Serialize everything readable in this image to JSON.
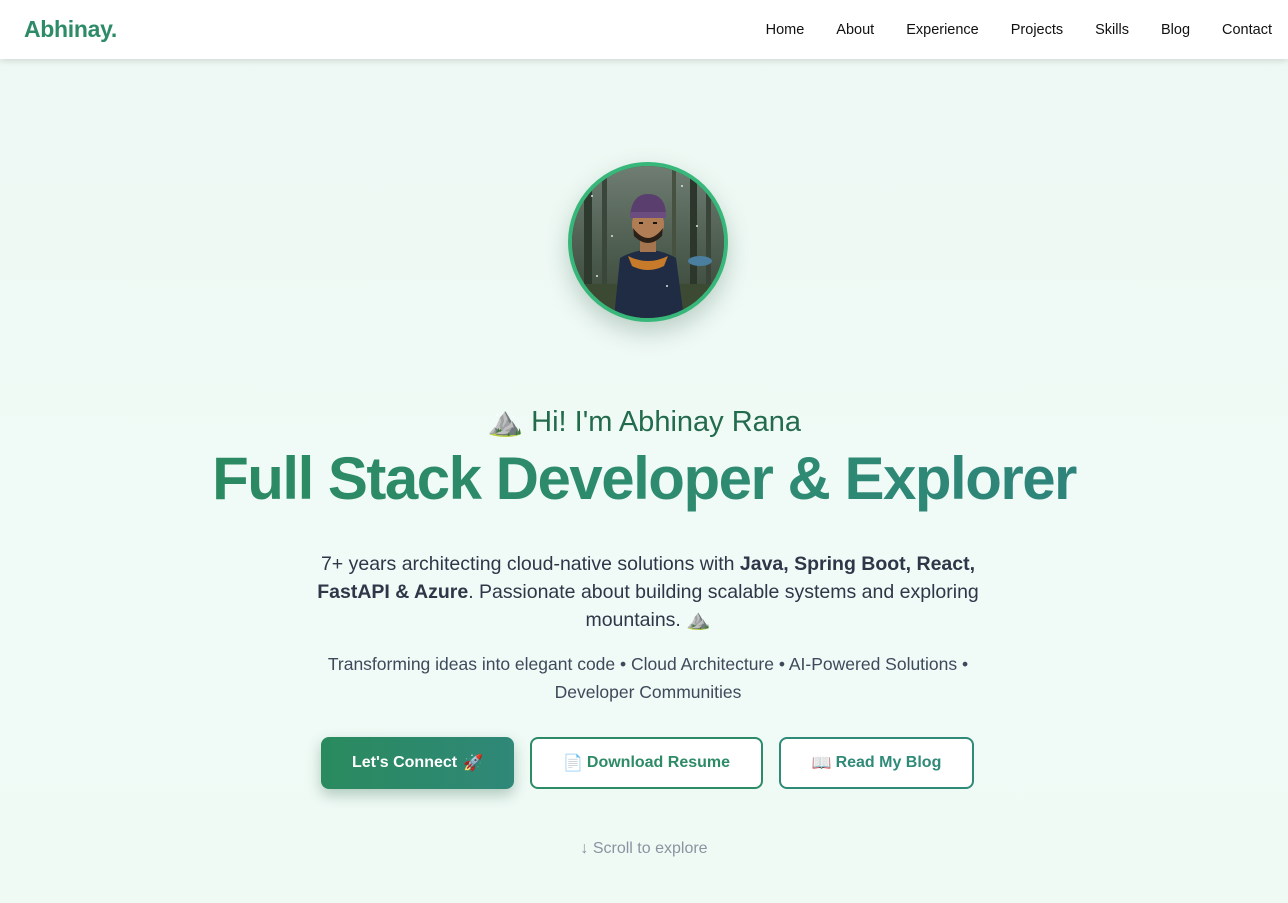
{
  "nav": {
    "logo": "Abhinay.",
    "links": [
      "Home",
      "About",
      "Experience",
      "Projects",
      "Skills",
      "Blog",
      "Contact"
    ]
  },
  "hero": {
    "greeting": "⛰️ Hi! I'm Abhinay Rana",
    "headline": "Full Stack Developer & Explorer",
    "intro_start": "7+ years architecting cloud-native solutions with ",
    "intro_bold": "Java, Spring Boot, React, FastAPI & Azure",
    "intro_end": ". Passionate about building scalable systems and exploring mountains. ⛰️",
    "tagline": "Transforming ideas into elegant code • Cloud Architecture • AI-Powered Solutions • Developer Communities",
    "buttons": {
      "connect": "Let's Connect",
      "connect_icon": "🚀",
      "resume_icon": "📄",
      "resume": "Download Resume",
      "blog_icon": "📖",
      "blog": "Read My Blog"
    },
    "scroll_hint": "↓ Scroll to explore"
  },
  "colors": {
    "accent": "#2e8b67",
    "avatar_ring": "#37b77a",
    "background": "#eef8f3"
  },
  "icons": {
    "avatar": "profile-photo"
  }
}
